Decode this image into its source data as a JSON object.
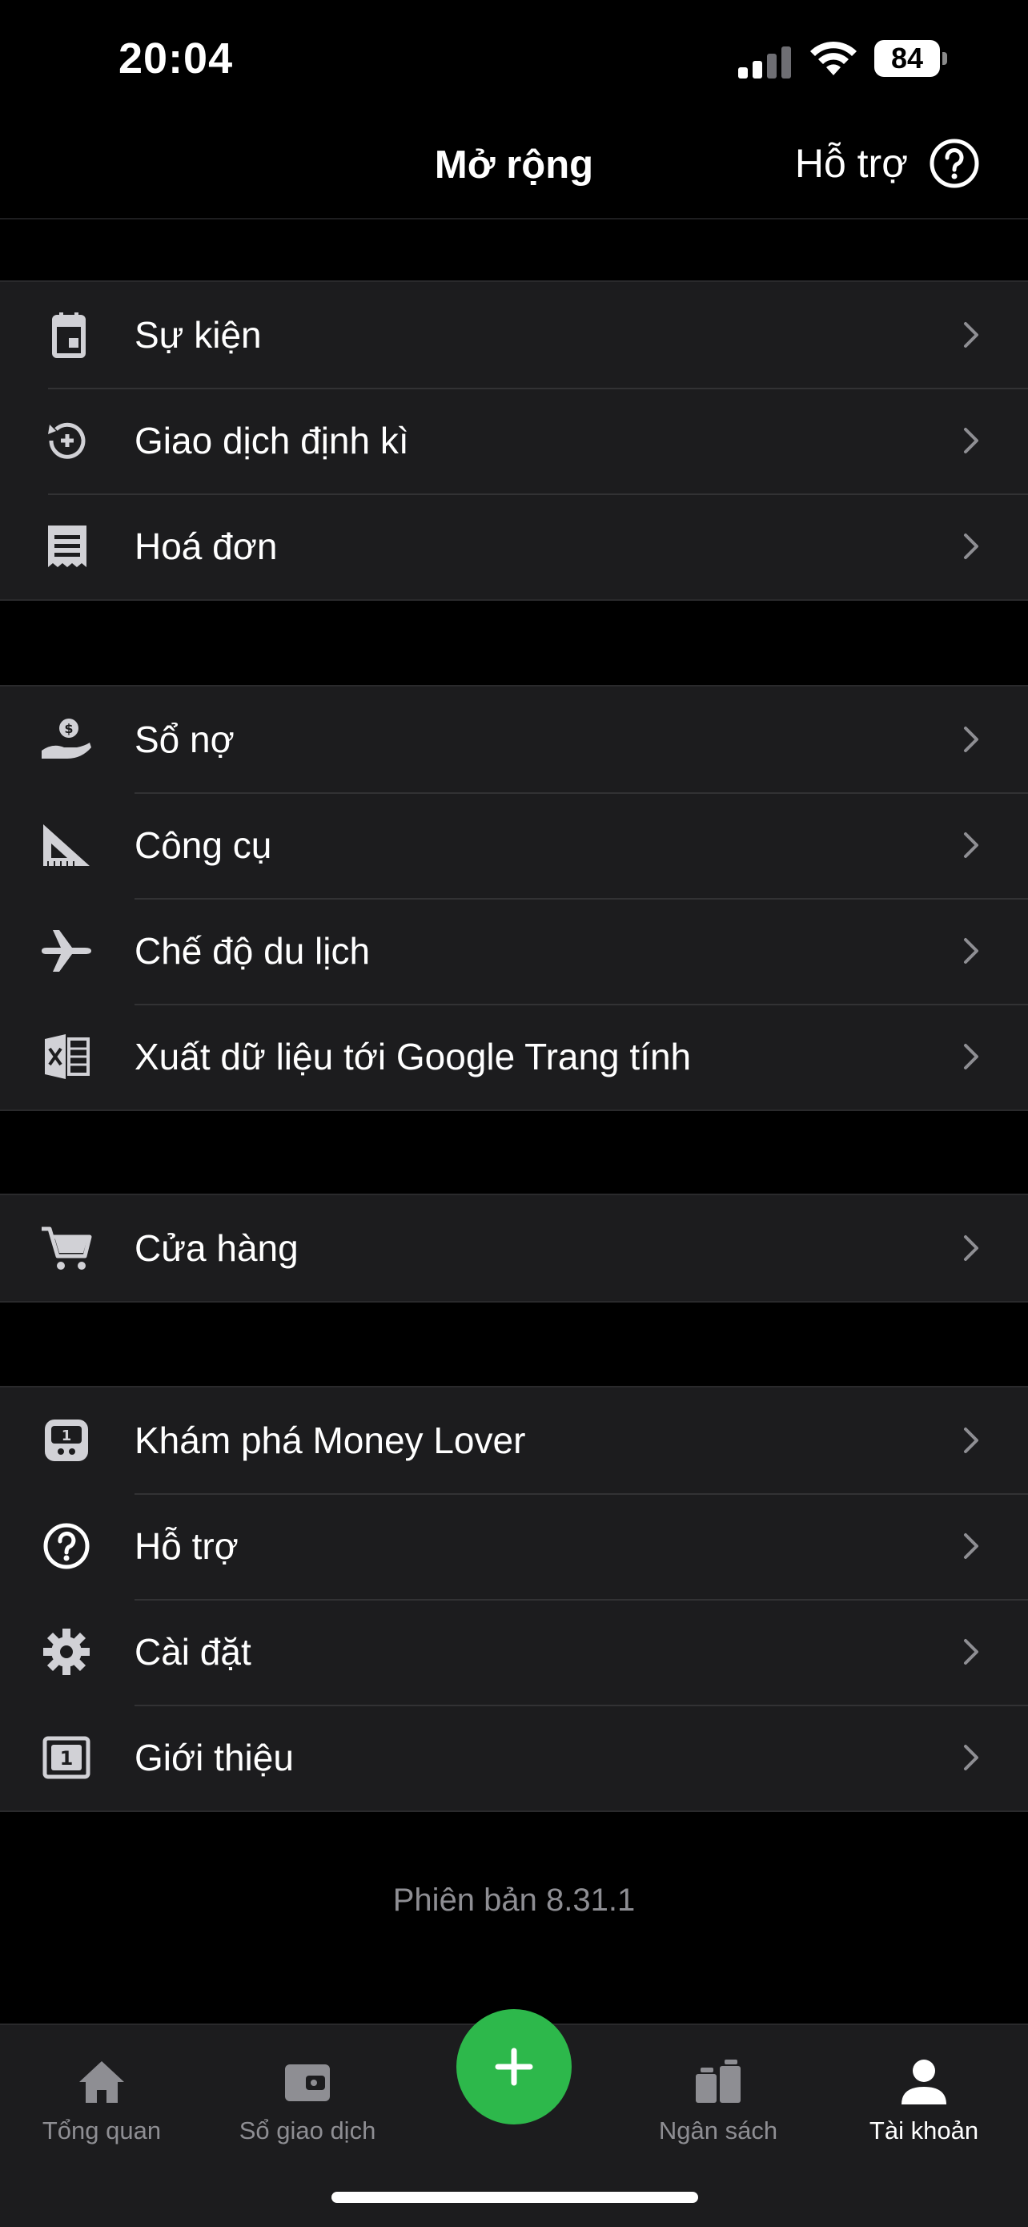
{
  "status_bar": {
    "time": "20:04",
    "battery": "84"
  },
  "header": {
    "title": "Mở rộng",
    "help_label": "Hỗ trợ"
  },
  "groups": [
    {
      "items": [
        {
          "label": "Sự kiện",
          "icon": "calendar-icon"
        },
        {
          "label": "Giao dịch định kì",
          "icon": "recurring-transaction-icon"
        },
        {
          "label": "Hoá đơn",
          "icon": "receipt-icon"
        }
      ]
    },
    {
      "items": [
        {
          "label": "Sổ nợ",
          "icon": "debt-hand-icon"
        },
        {
          "label": "Công cụ",
          "icon": "ruler-triangle-icon"
        },
        {
          "label": "Chế độ du lịch",
          "icon": "airplane-icon"
        },
        {
          "label": "Xuất dữ liệu tới Google Trang tính",
          "icon": "spreadsheet-export-icon"
        }
      ]
    },
    {
      "items": [
        {
          "label": "Cửa hàng",
          "icon": "shopping-cart-icon"
        }
      ]
    },
    {
      "items": [
        {
          "label": "Khám phá Money Lover",
          "icon": "money-lover-icon"
        },
        {
          "label": "Hỗ trợ",
          "icon": "help-circle-icon"
        },
        {
          "label": "Cài đặt",
          "icon": "gear-icon"
        },
        {
          "label": "Giới thiệu",
          "icon": "about-icon"
        }
      ]
    }
  ],
  "version": "Phiên bản 8.31.1",
  "tabs": [
    {
      "label": "Tổng quan",
      "icon": "home-icon",
      "active": false
    },
    {
      "label": "Sổ giao dịch",
      "icon": "wallet-icon",
      "active": false
    },
    {
      "label": "Ngân sách",
      "icon": "budget-icon",
      "active": false
    },
    {
      "label": "Tài khoản",
      "icon": "person-icon",
      "active": true
    }
  ],
  "colors": {
    "accent": "#2db84b",
    "background": "#000000",
    "surface": "#1c1c1e",
    "muted": "#8e8e93"
  }
}
